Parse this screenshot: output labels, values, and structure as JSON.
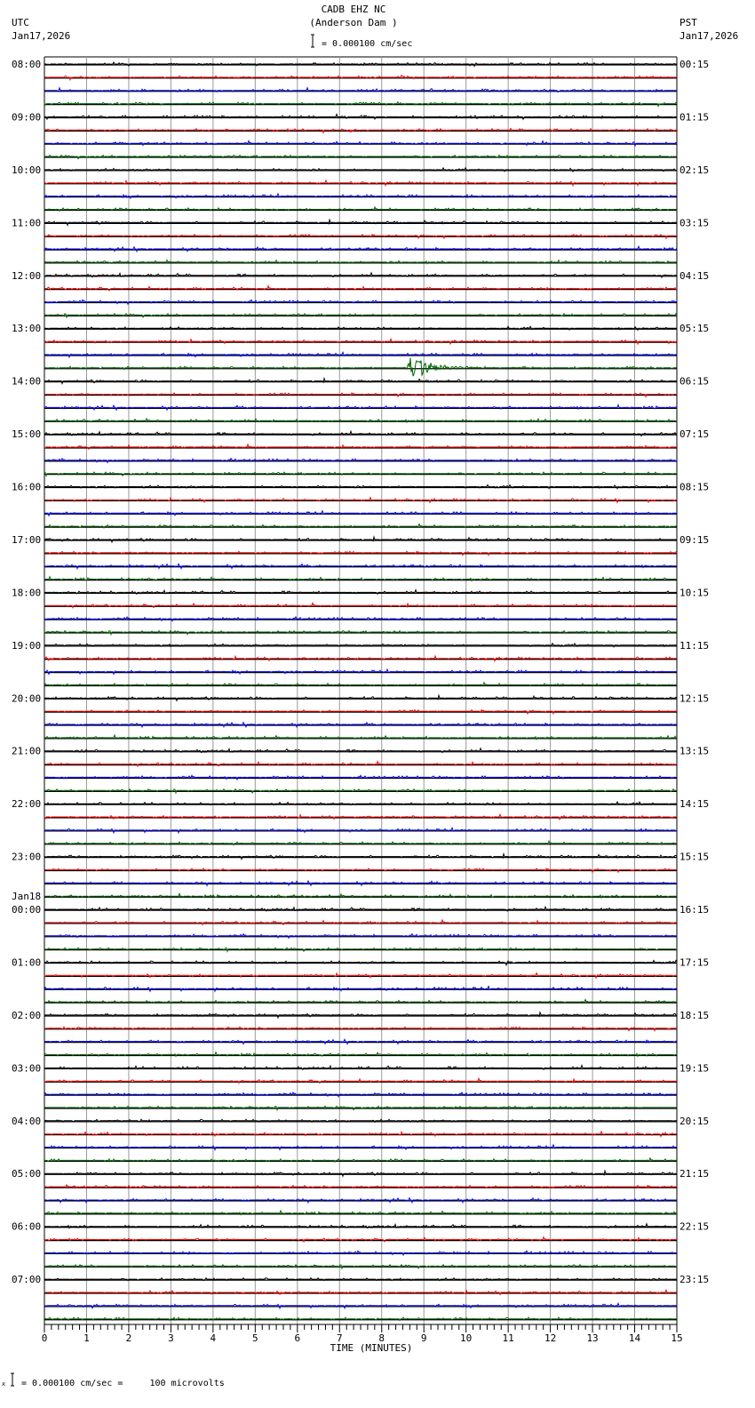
{
  "header": {
    "station": "CADB EHZ NC",
    "location": "(Anderson Dam )",
    "scale": "= 0.000100 cm/sec",
    "left_tz": "UTC",
    "left_date": "Jan17,2026",
    "right_tz": "PST",
    "right_date": "Jan17,2026"
  },
  "footer": {
    "scale_note": "= 0.000100 cm/sec =     100 microvolts"
  },
  "chart_data": {
    "type": "line",
    "title": "CADB EHZ NC (Anderson Dam )",
    "xlabel": "TIME (MINUTES)",
    "xlim": [
      0,
      15
    ],
    "x_ticks": [
      "0",
      "1",
      "2",
      "3",
      "4",
      "5",
      "6",
      "7",
      "8",
      "9",
      "10",
      "11",
      "12",
      "13",
      "14",
      "15"
    ],
    "minutes_per_trace": 15,
    "trace_count": 96,
    "trace_colors": [
      "#000000",
      "#ff0000",
      "#0000ff",
      "#006400"
    ],
    "left_labels": [
      {
        "trace": 0,
        "text": "08:00"
      },
      {
        "trace": 4,
        "text": "09:00"
      },
      {
        "trace": 8,
        "text": "10:00"
      },
      {
        "trace": 12,
        "text": "11:00"
      },
      {
        "trace": 16,
        "text": "12:00"
      },
      {
        "trace": 20,
        "text": "13:00"
      },
      {
        "trace": 24,
        "text": "14:00"
      },
      {
        "trace": 28,
        "text": "15:00"
      },
      {
        "trace": 32,
        "text": "16:00"
      },
      {
        "trace": 36,
        "text": "17:00"
      },
      {
        "trace": 40,
        "text": "18:00"
      },
      {
        "trace": 44,
        "text": "19:00"
      },
      {
        "trace": 48,
        "text": "20:00"
      },
      {
        "trace": 52,
        "text": "21:00"
      },
      {
        "trace": 56,
        "text": "22:00"
      },
      {
        "trace": 60,
        "text": "23:00"
      },
      {
        "trace": 64,
        "text": "00:00",
        "date": "Jan18"
      },
      {
        "trace": 68,
        "text": "01:00"
      },
      {
        "trace": 72,
        "text": "02:00"
      },
      {
        "trace": 76,
        "text": "03:00"
      },
      {
        "trace": 80,
        "text": "04:00"
      },
      {
        "trace": 84,
        "text": "05:00"
      },
      {
        "trace": 88,
        "text": "06:00"
      },
      {
        "trace": 92,
        "text": "07:00"
      }
    ],
    "right_labels": [
      {
        "trace": 0,
        "text": "00:15"
      },
      {
        "trace": 4,
        "text": "01:15"
      },
      {
        "trace": 8,
        "text": "02:15"
      },
      {
        "trace": 12,
        "text": "03:15"
      },
      {
        "trace": 16,
        "text": "04:15"
      },
      {
        "trace": 20,
        "text": "05:15"
      },
      {
        "trace": 24,
        "text": "06:15"
      },
      {
        "trace": 28,
        "text": "07:15"
      },
      {
        "trace": 32,
        "text": "08:15"
      },
      {
        "trace": 36,
        "text": "09:15"
      },
      {
        "trace": 40,
        "text": "10:15"
      },
      {
        "trace": 44,
        "text": "11:15"
      },
      {
        "trace": 48,
        "text": "12:15"
      },
      {
        "trace": 52,
        "text": "13:15"
      },
      {
        "trace": 56,
        "text": "14:15"
      },
      {
        "trace": 60,
        "text": "15:15"
      },
      {
        "trace": 64,
        "text": "16:15"
      },
      {
        "trace": 68,
        "text": "17:15"
      },
      {
        "trace": 72,
        "text": "18:15"
      },
      {
        "trace": 76,
        "text": "19:15"
      },
      {
        "trace": 80,
        "text": "20:15"
      },
      {
        "trace": 84,
        "text": "21:15"
      },
      {
        "trace": 88,
        "text": "22:15"
      },
      {
        "trace": 92,
        "text": "23:15"
      }
    ],
    "events": [
      {
        "trace": 23,
        "start_min": 8.6,
        "end_min": 10.5,
        "peak_amplitude": 18
      },
      {
        "trace": 24,
        "start_min": 12.2,
        "end_min": 12.6,
        "peak_amplitude": 2
      },
      {
        "trace": 66,
        "start_min": 0.5,
        "end_min": 0.9,
        "peak_amplitude": 2
      },
      {
        "trace": 68,
        "start_min": 10.9,
        "end_min": 11.4,
        "peak_amplitude": 5
      }
    ]
  }
}
